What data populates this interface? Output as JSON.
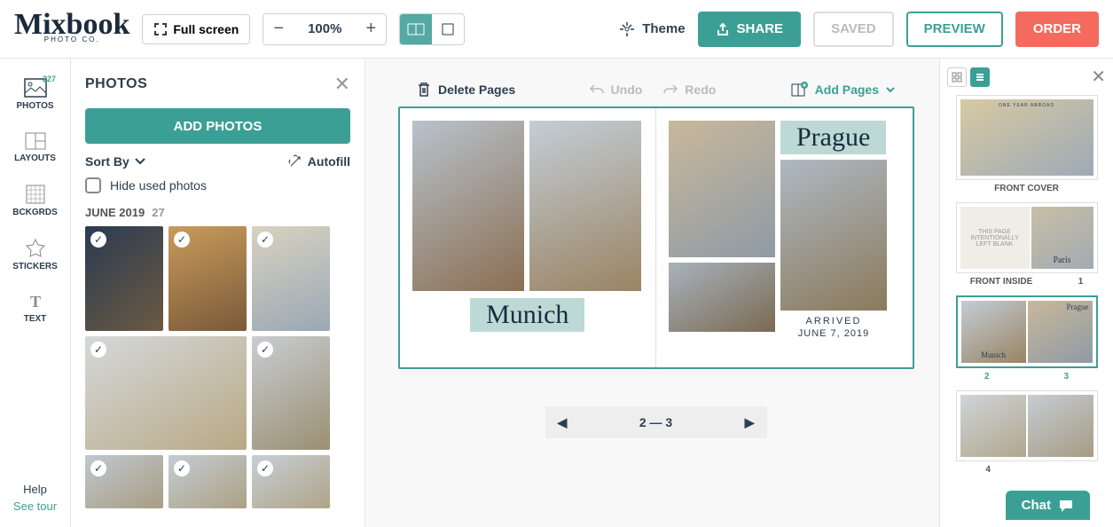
{
  "header": {
    "logo_sub": "PHOTO CO.",
    "fullscreen": "Full screen",
    "zoom": "100%",
    "theme": "Theme",
    "share": "SHARE",
    "saved": "SAVED",
    "preview": "PREVIEW",
    "order": "ORDER"
  },
  "leftnav": {
    "photos": "PHOTOS",
    "photos_badge": "227",
    "layouts": "LAYOUTS",
    "bckgrds": "BCKGRDS",
    "stickers": "STICKERS",
    "text": "TEXT",
    "help": "Help",
    "seetour": "See tour"
  },
  "photos_panel": {
    "title": "PHOTOS",
    "add": "ADD PHOTOS",
    "sortby": "Sort By",
    "autofill": "Autofill",
    "hide": "Hide used photos",
    "group_date": "JUNE 2019",
    "group_count": "27"
  },
  "canvas": {
    "delete": "Delete Pages",
    "undo": "Undo",
    "redo": "Redo",
    "addpages": "Add Pages",
    "left_title": "Munich",
    "right_title": "Prague",
    "arrived": "ARRIVED",
    "arrived_date": "JUNE 7, 2019",
    "pager": "2 — 3"
  },
  "right": {
    "front_cover": "FRONT COVER",
    "front_inside": "FRONT INSIDE",
    "page1": "1",
    "page2": "2",
    "page3": "3",
    "page4": "4",
    "blank_text": "THIS PAGE INTENTIONALLY LEFT BLANK",
    "cover_top": "ONE YEAR ABROAD",
    "mini_munich": "Munich",
    "mini_prague": "Prague",
    "mini_paris": "Paris"
  },
  "chat": "Chat"
}
